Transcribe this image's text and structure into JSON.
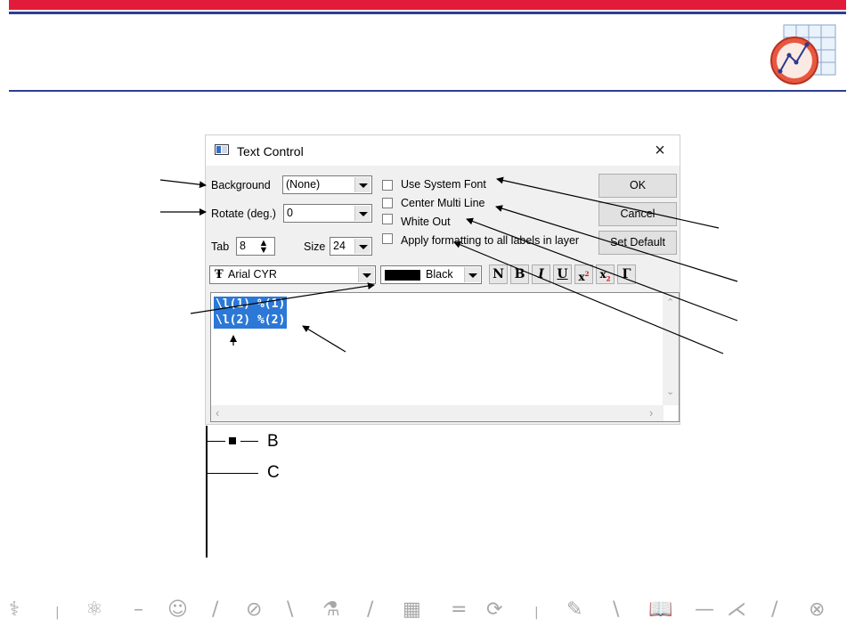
{
  "dialog": {
    "title": "Text Control",
    "background_label": "Background",
    "background_value": "(None)",
    "rotate_label": "Rotate (deg.)",
    "rotate_value": "0",
    "tab_label": "Tab",
    "tab_value": "8",
    "size_label": "Size",
    "size_value": "24",
    "font_value": "Arial CYR",
    "color_value": "Black",
    "checkboxes": {
      "system_font": "Use System Font",
      "center_multi": "Center Multi Line",
      "white_out": "White Out",
      "apply_all": "Apply formatting to all labels in layer"
    },
    "buttons": {
      "ok": "OK",
      "cancel": "Cancel",
      "set_default": "Set Default"
    },
    "format_buttons": {
      "normal": "N",
      "bold": "B",
      "italic": "I",
      "underline": "U",
      "superscript": "x",
      "subscript": "x",
      "greek": "Γ"
    },
    "text_lines": [
      "\\l(1) %(1)",
      "\\l(2) %(2)"
    ]
  },
  "legend": {
    "series": [
      "B",
      "C"
    ]
  },
  "colors": {
    "brand_red": "#e31b3a",
    "brand_blue": "#2d3f8f",
    "selection": "#2b78d6"
  },
  "footer_icons": [
    "dna-icon",
    "atom-icon",
    "lightbulb-head-icon",
    "compass-icon",
    "flask-icon",
    "calculator-icon",
    "atom-cycle-icon",
    "writing-icon",
    "book-icon",
    "network-icon",
    "basketball-icon"
  ]
}
